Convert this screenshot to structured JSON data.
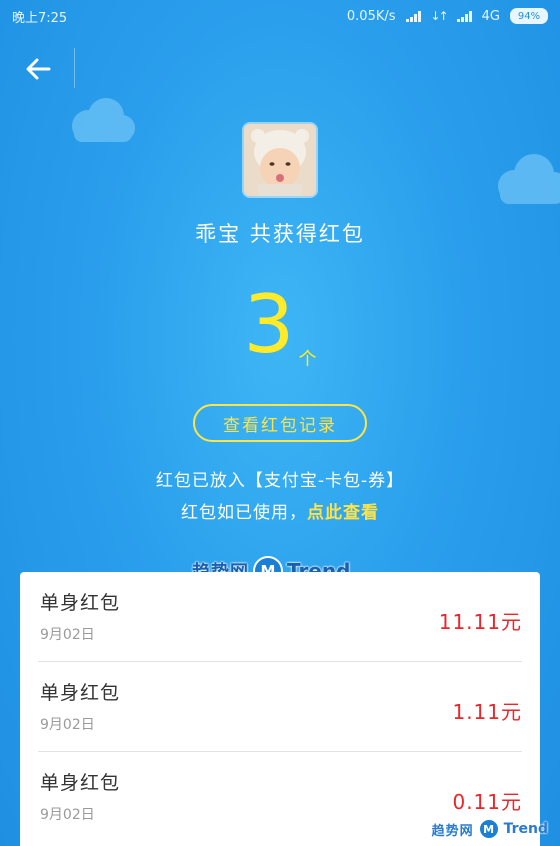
{
  "status_bar": {
    "time": "晚上7:25",
    "network_speed": "0.05K/s",
    "network_type": "4G",
    "battery": "94%"
  },
  "header": {
    "back_icon": "arrow-left-icon"
  },
  "profile": {
    "avatar_icon": "child-avatar"
  },
  "summary": {
    "headline": "乖宝 共获得红包",
    "count": "3",
    "count_unit": "个"
  },
  "actions": {
    "record_button": "查看红包记录"
  },
  "info": {
    "line1": "红包已放入【支付宝-卡包-券】",
    "line2_prefix": "红包如已使用，",
    "line2_link": "点此查看"
  },
  "watermark": {
    "cn": "趋势网",
    "logo": "M",
    "en": "Trend"
  },
  "list": [
    {
      "title": "单身红包",
      "date": "9月02日",
      "amount": "11.11元"
    },
    {
      "title": "单身红包",
      "date": "9月02日",
      "amount": "1.11元"
    },
    {
      "title": "单身红包",
      "date": "9月02日",
      "amount": "0.11元"
    }
  ],
  "colors": {
    "background": "#2a9fec",
    "accent_yellow": "#ffeb2a",
    "amount_red": "#e8262b"
  }
}
